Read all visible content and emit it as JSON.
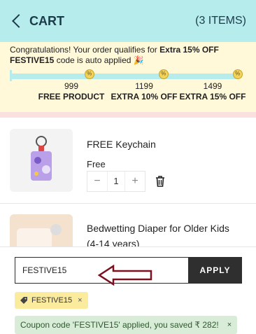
{
  "header": {
    "title": "CART",
    "count": "(3 ITEMS)"
  },
  "offer": {
    "text_before": "Congratulations! Your order qualifies for ",
    "bold_offer": "Extra 15% OFF",
    "newline_code": "FESTIVE15",
    "text_after": " code is auto applied",
    "party_icon": "🎉",
    "milestones": [
      {
        "amount": "999",
        "label": "FREE PRODUCT"
      },
      {
        "amount": "1199",
        "label": "EXTRA 10% OFF"
      },
      {
        "amount": "1499",
        "label": "EXTRA 15% OFF"
      }
    ],
    "milestone_icon": "%",
    "progress": 1.0
  },
  "items": [
    {
      "name": "FREE Keychain",
      "price": "Free",
      "qty": "1",
      "minus": "−",
      "plus": "+"
    },
    {
      "name": "Bedwetting Diaper for Older Kids",
      "subtitle": "(4-14 years)"
    }
  ],
  "coupon": {
    "input_value": "FESTIVE15",
    "apply_label": "APPLY",
    "chip_code": "FESTIVE15",
    "chip_close": "×",
    "success_text": "Coupon code 'FESTIVE15' applied, you saved ₹ 282!",
    "success_close": "×"
  },
  "colors": {
    "header_bg": "#b6ecec",
    "offer_bg": "#fff8d9",
    "apply_bg": "#2f2f2f",
    "arrow": "#7a1020",
    "chip_bg": "#fbeb9c",
    "success_bg": "#d8ecd8"
  }
}
